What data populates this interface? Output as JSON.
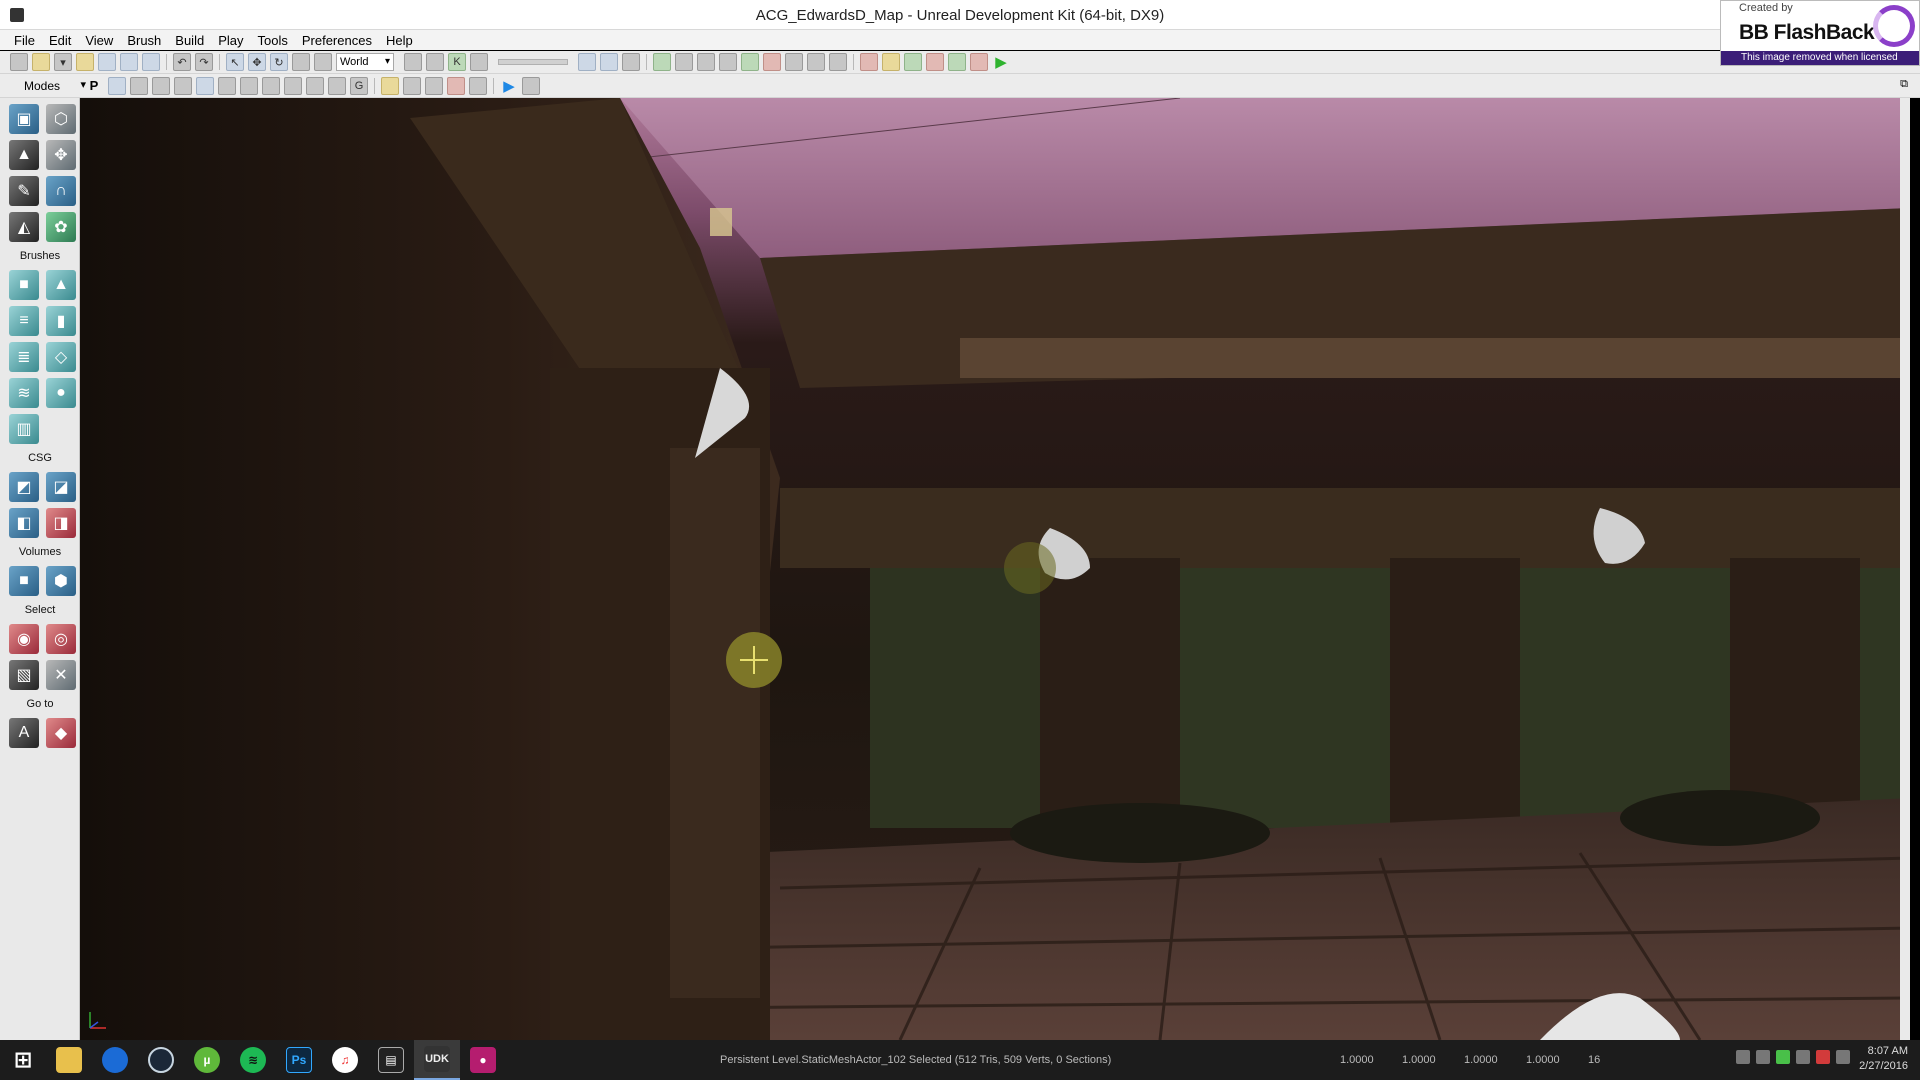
{
  "window": {
    "title": "ACG_EdwardsD_Map - Unreal Development Kit (64-bit, DX9)"
  },
  "watermark": {
    "created_by": "Created by",
    "brand": "BB FlashBack",
    "note": "This image removed when licensed"
  },
  "menu": [
    "File",
    "Edit",
    "View",
    "Brush",
    "Build",
    "Play",
    "Tools",
    "Preferences",
    "Help"
  ],
  "toolbar": {
    "coordinate_system": "World",
    "p_label": "P",
    "g_label": "G",
    "k_label": "K"
  },
  "modes_panel": {
    "title": "Modes",
    "sections": {
      "brushes": "Brushes",
      "csg": "CSG",
      "volumes": "Volumes",
      "select": "Select",
      "goto": "Go to"
    }
  },
  "status": {
    "selection": "Persistent Level.StaticMeshActor_102 Selected (512 Tris, 509 Verts, 0 Sections)",
    "coords": [
      "1.0000",
      "1.0000",
      "1.0000",
      "1.0000"
    ],
    "grid": "16"
  },
  "taskbar": {
    "udk_label": "UDK",
    "ps_label": "Ps"
  },
  "clock": {
    "time": "8:07 AM",
    "date": "2/27/2016"
  },
  "colors": {
    "sky": "#b07a9a",
    "accent": "#2fb32f"
  }
}
